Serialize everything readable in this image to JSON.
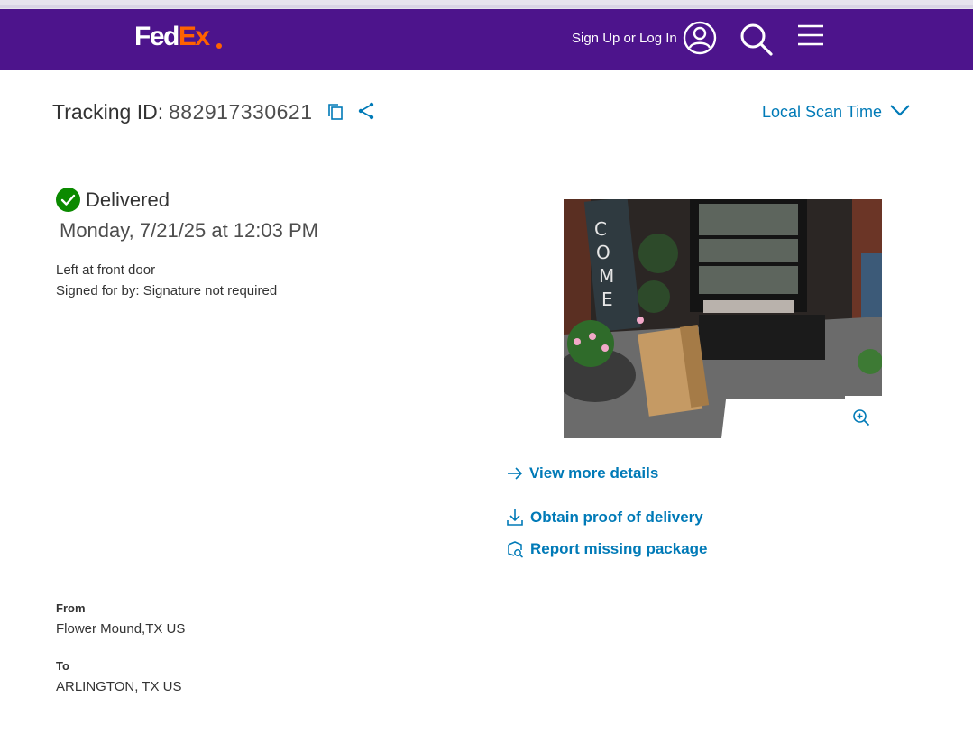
{
  "header": {
    "logo_fed": "Fed",
    "logo_ex": "Ex",
    "sign_in": "Sign Up or Log In",
    "brand_color": "#4d148c",
    "accent_color": "#ff6200"
  },
  "tracking": {
    "label": "Tracking ID:",
    "id": "882917330621",
    "scan_time_toggle": "Local Scan Time"
  },
  "status": {
    "state": "Delivered",
    "datetime": "Monday, 7/21/25 at 12:03 PM",
    "note": "Left at front door",
    "signed": "Signed for by: Signature not required",
    "status_color": "#0b8a00"
  },
  "actions": {
    "view_details": "View more details",
    "proof": "Obtain proof of delivery",
    "report": "Report missing package",
    "link_color": "#007ab7"
  },
  "route": {
    "from_label": "From",
    "from": "Flower Mound,TX US",
    "to_label": "To",
    "to": "ARLINGTON, TX US"
  },
  "icons": [
    "user-icon",
    "search-icon",
    "menu-icon",
    "copy-icon",
    "share-icon",
    "chevron-down-icon",
    "check-circle-icon",
    "zoom-in-icon",
    "arrow-right-icon",
    "download-icon",
    "package-search-icon"
  ]
}
